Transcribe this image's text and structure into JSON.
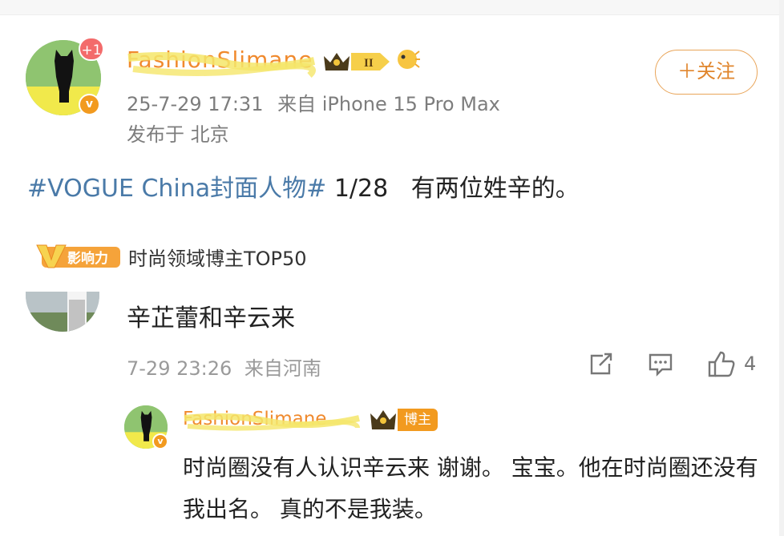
{
  "post": {
    "author": {
      "name": "FashionSlimane",
      "notification_count": "+1",
      "level_badge": "II",
      "verified_mark": "v"
    },
    "timestamp": "25-7-29 17:31",
    "source": "来自 iPhone 15 Pro Max",
    "location": "发布于 北京",
    "follow_label": "＋关注",
    "hashtag": "#VOGUE China封面人物#",
    "body": " 1/28   有两位姓辛的。",
    "influence_badge": "影响力",
    "rank_label": "时尚领域博主TOP50"
  },
  "comment": {
    "text": "辛芷蕾和辛云来",
    "timestamp": "7-29 23:26",
    "source": "来自河南",
    "like_count": "4"
  },
  "reply": {
    "author_name": "FashionSlimane",
    "author_tag": "博主",
    "verified_mark": "v",
    "text": "时尚圈没有人认识辛云来 谢谢。 宝宝。他在时尚圈还没有我出名。 真的不是我装。"
  },
  "colors": {
    "accent_orange": "#f08a2e",
    "hashtag_blue": "#4a7aa8",
    "meta_gray": "#7d7d7d"
  },
  "icons": [
    "share-icon",
    "comment-icon",
    "like-icon",
    "crown-icon",
    "fish-icon"
  ]
}
